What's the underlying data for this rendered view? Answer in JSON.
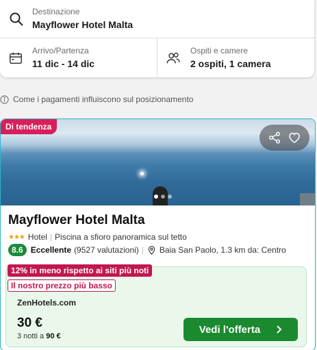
{
  "search": {
    "destination_label": "Destinazione",
    "destination_value": "Mayflower Hotel Malta",
    "dates_label": "Arrivo/Partenza",
    "dates_value": "11 dic - 14 dic",
    "guests_label": "Ospiti e camere",
    "guests_value": "2 ospiti, 1 camera"
  },
  "info_text": "Come i pagamenti influiscono sul posizionamento",
  "hotel": {
    "trend_badge": "Di tendenza",
    "name": "Mayflower Hotel Malta",
    "stars": "★★★",
    "type": "Hotel",
    "feature": "Piscina a sfioro panoramica sul tetto",
    "score": "8.6",
    "rating_word": "Eccellente",
    "reviews": "(9527 valutazioni)",
    "location": "Baia San Paolo, 1.3 km da: Centro",
    "photo_dots": 3
  },
  "offer": {
    "promo_discount": "12% in meno rispetto ai siti più noti",
    "promo_lowest": "Il nostro prezzo più basso",
    "provider": "ZenHotels.com",
    "price": "30 €",
    "nights_text": "3 notti a",
    "total": "90 €",
    "cta_label": "Vedi l'offerta"
  },
  "colors": {
    "trend": "#d81e5b",
    "promo": "#c2174e",
    "score": "#1b8a3a",
    "cta": "#1b8a2f",
    "card_border": "#2db6c8"
  },
  "icons": [
    "search-icon",
    "calendar-icon",
    "people-icon",
    "info-icon",
    "share-icon",
    "heart-icon",
    "map-pin-icon",
    "chevron-right-icon"
  ]
}
